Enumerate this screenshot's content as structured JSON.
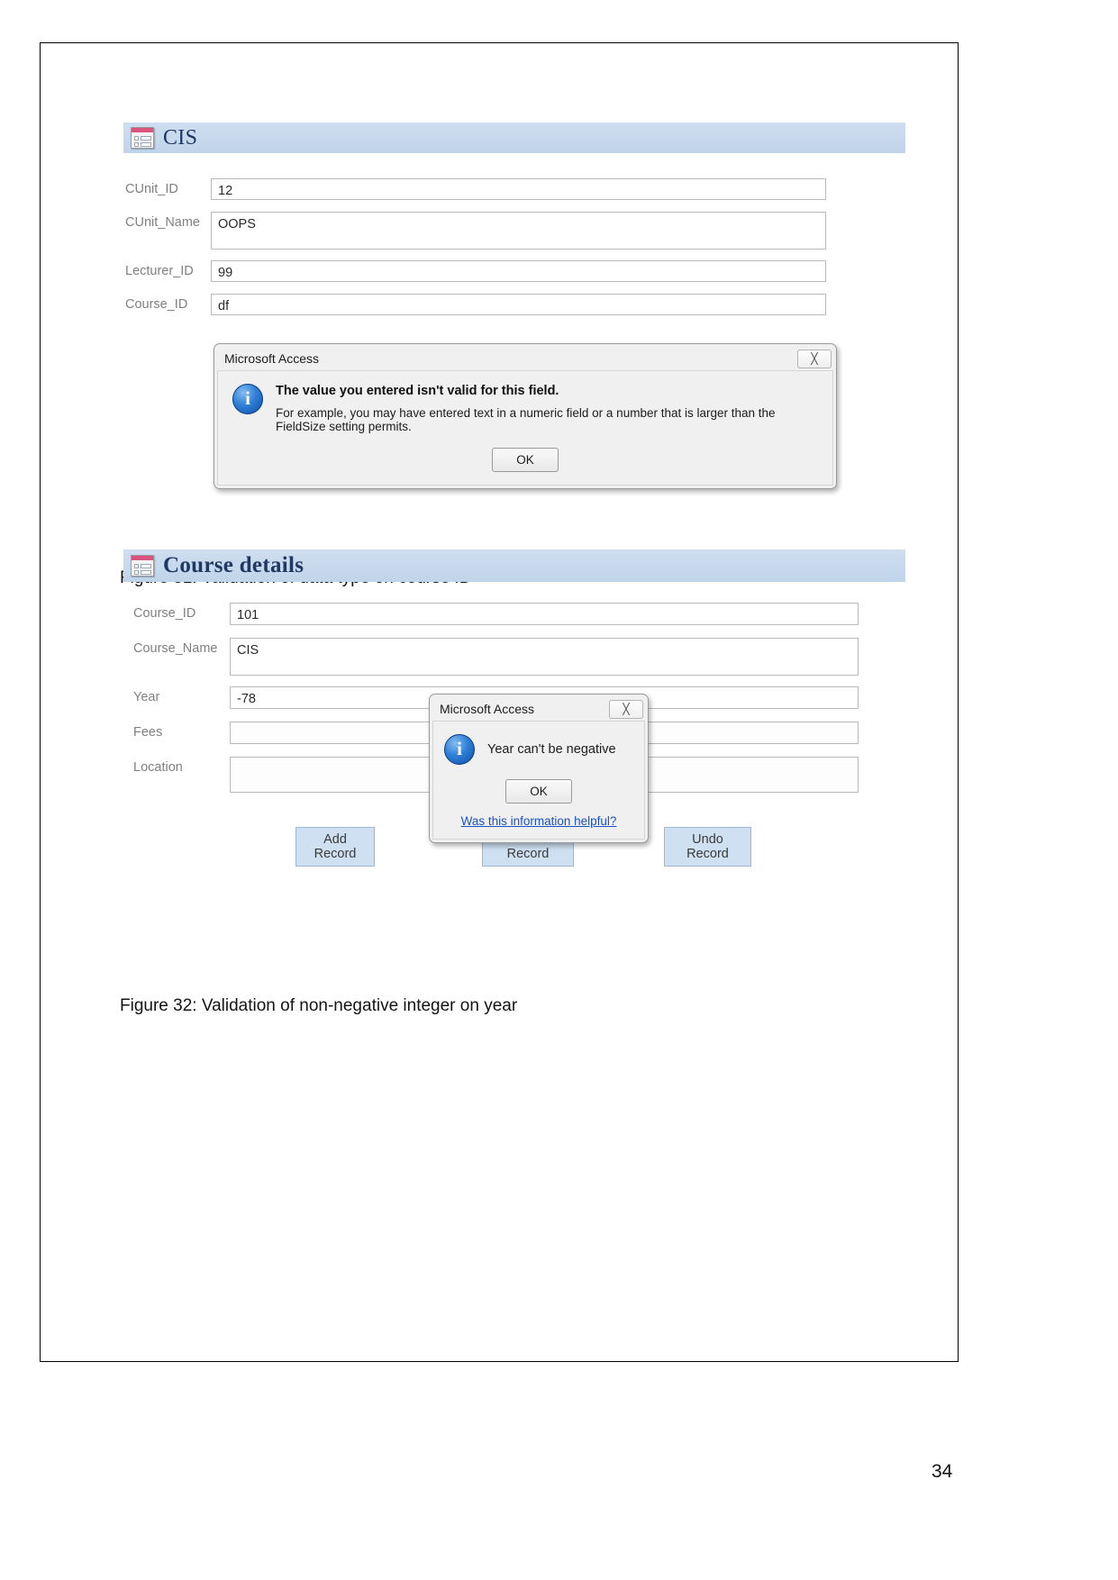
{
  "document": {
    "page_number": "34",
    "captions": [
      "Figure 31: Validation of data type on course ID",
      "Figure 32: Validation of non-negative integer on year"
    ]
  },
  "figure31": {
    "form": {
      "title": "CIS",
      "icon": "access-form-icon",
      "fields": [
        {
          "label": "CUnit_ID",
          "value": "12"
        },
        {
          "label": "CUnit_Name",
          "value": "OOPS"
        },
        {
          "label": "Lecturer_ID",
          "value": "99"
        },
        {
          "label": "Course_ID",
          "value": "df"
        }
      ]
    },
    "dialog": {
      "title": "Microsoft Access",
      "close_glyph": "╳",
      "heading": "The value you entered isn't valid for this field.",
      "body": "For example, you may have entered text in a numeric field or a number that is larger than the FieldSize setting permits.",
      "ok_label": "OK"
    }
  },
  "figure32": {
    "form": {
      "title": "Course details",
      "icon": "access-form-icon",
      "fields": [
        {
          "label": "Course_ID",
          "value": "101"
        },
        {
          "label": "Course_Name",
          "value": "CIS"
        },
        {
          "label": "Year",
          "value": "-78"
        },
        {
          "label": "Fees",
          "value": ""
        },
        {
          "label": "Location",
          "value": ""
        }
      ],
      "buttons": [
        {
          "label": "Add Record"
        },
        {
          "label": "Delete Record"
        },
        {
          "label": "Undo Record"
        }
      ]
    },
    "dialog": {
      "title": "Microsoft Access",
      "close_glyph": "╳",
      "message": "Year can't be negative",
      "ok_label": "OK",
      "help_link": "Was this information helpful?"
    }
  },
  "colors": {
    "header_band": "#c5d9ef",
    "title_text": "#1f3864",
    "label_text": "#808080",
    "button_face": "#cfe0f2",
    "link": "#1a52c4"
  }
}
